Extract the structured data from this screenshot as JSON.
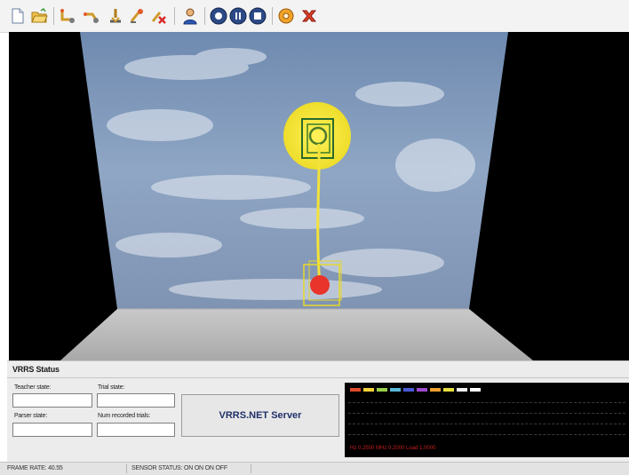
{
  "toolbar": {
    "buttons": [
      {
        "icon": "new-file-icon"
      },
      {
        "icon": "open-folder-icon"
      },
      {
        "icon": "tool-arm-icon"
      },
      {
        "icon": "tool-arm-alt-icon"
      },
      {
        "icon": "tool-reach-icon"
      },
      {
        "icon": "tool-grab-icon"
      },
      {
        "icon": "tool-remove-icon"
      },
      {
        "icon": "user-icon"
      },
      {
        "icon": "record-icon"
      },
      {
        "icon": "pause-icon"
      },
      {
        "icon": "stop-icon"
      },
      {
        "icon": "settings-icon"
      },
      {
        "icon": "exit-icon"
      }
    ]
  },
  "status_panel": {
    "title": "VRRS Status",
    "teacher_state_label": "Teacher state:",
    "teacher_state_value": "",
    "trial_state_label": "Trial state:",
    "trial_state_value": "",
    "parser_state_label": "Parser state:",
    "parser_state_value": "",
    "num_recorded_trials_label": "Num recorded trials:",
    "num_recorded_trials_value": "",
    "server_button": "VRRS.NET Server",
    "graph": {
      "series_colors": [
        "#e04a2a",
        "#f2d23a",
        "#9ad04a",
        "#5ab8d8",
        "#4a5ad8",
        "#a04ad0",
        "#f0a030",
        "#e8e040",
        "#f0f0f0",
        "#ffffff"
      ],
      "readout": "Hz 0.2500  MHz 0.2000  Load 1.0000"
    }
  },
  "statusbar": {
    "frame_rate": "FRAME RATE: 40.55",
    "sensor_status": "SENSOR STATUS: ON ON ON OFF"
  }
}
